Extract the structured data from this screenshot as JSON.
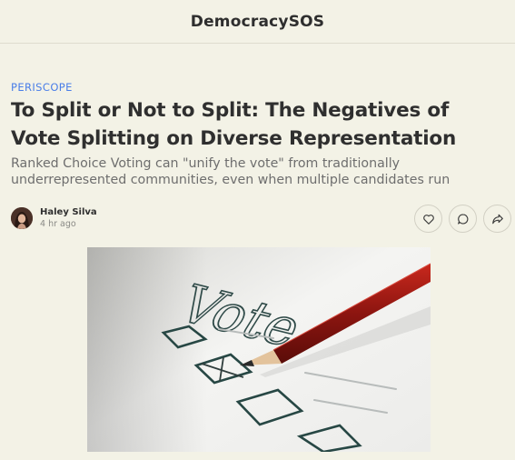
{
  "header": {
    "brand": "DemocracySOS"
  },
  "article": {
    "kicker": "PERISCOPE",
    "title": "To Split or Not to Split: The Negatives of Vote Splitting on Diverse Representation",
    "subtitle": "Ranked Choice Voting can \"unify the vote\" from traditionally underrepresented communities, even when multiple candidates run",
    "author": "Haley Silva",
    "time": "4 hr ago",
    "image_text": "Vote"
  },
  "actions": [
    {
      "name": "like",
      "icon": "heart-icon"
    },
    {
      "name": "comment",
      "icon": "comment-icon"
    },
    {
      "name": "share",
      "icon": "share-icon"
    }
  ],
  "colors": {
    "background": "#f3f2e6",
    "kicker": "#4a7ee8",
    "title": "#2f2f2f",
    "subtitle": "#6e6e6e"
  }
}
